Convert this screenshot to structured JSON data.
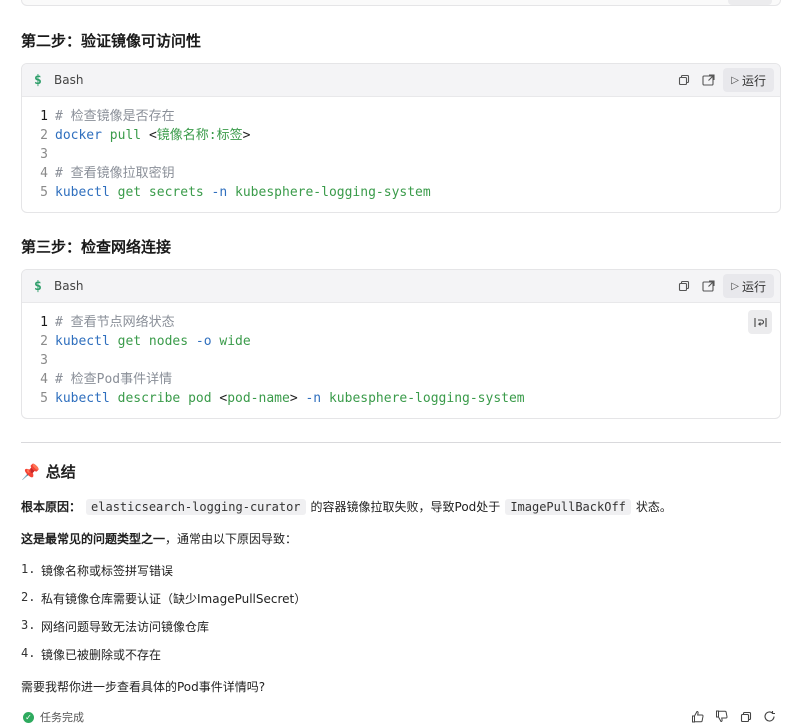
{
  "step2": {
    "title": "第二步：验证镜像可访问性",
    "code": {
      "lang_icon": "$",
      "lang": "Bash",
      "run_label": "运行",
      "lines": [
        {
          "n": "1",
          "comment": "# 检查镜像是否存在"
        },
        {
          "n": "2",
          "cmd": "docker",
          "args": " pull ",
          "plain": "<",
          "kw": "镜像名称:标签",
          "plain2": ">"
        },
        {
          "n": "3"
        },
        {
          "n": "4",
          "comment": "# 查看镜像拉取密钥"
        },
        {
          "n": "5",
          "cmd": "kubectl",
          "args": " get secrets ",
          "flag": "-n",
          "kw": " kubesphere-logging-system"
        }
      ]
    }
  },
  "step3": {
    "title": "第三步：检查网络连接",
    "code": {
      "lang_icon": "$",
      "lang": "Bash",
      "run_label": "运行",
      "lines": [
        {
          "n": "1",
          "comment": "# 查看节点网络状态"
        },
        {
          "n": "2",
          "cmd": "kubectl",
          "args": " get nodes ",
          "flag": "-o",
          "kw": " wide"
        },
        {
          "n": "3"
        },
        {
          "n": "4",
          "comment": "# 检查Pod事件详情"
        },
        {
          "n": "5",
          "cmd": "kubectl",
          "args": " describe pod ",
          "plain": "<",
          "kw": "pod-name",
          "plain2": "> ",
          "flag": "-n",
          "kw2": " kubesphere-logging-system"
        }
      ]
    }
  },
  "summary": {
    "title": "总结",
    "pin_icon": "pushpin-icon",
    "root_cause_label": "根本原因：",
    "root_cause_code1": "elasticsearch-logging-curator",
    "root_cause_text1": "的容器镜像拉取失败，导致Pod处于",
    "root_cause_code2": "ImagePullBackOff",
    "root_cause_text2": "状态。",
    "common_bold": "这是最常见的问题类型之一",
    "common_rest": "，通常由以下原因导致：",
    "reasons": [
      {
        "n": "1.",
        "text": "镜像名称或标签拼写错误"
      },
      {
        "n": "2.",
        "text": "私有镜像仓库需要认证（缺少ImagePullSecret）"
      },
      {
        "n": "3.",
        "text": "网络问题导致无法访问镜像仓库"
      },
      {
        "n": "4.",
        "text": "镜像已被删除或不存在"
      }
    ],
    "question": "需要我帮你进一步查看具体的Pod事件详情吗?"
  },
  "footer": {
    "status": "任务完成",
    "status_color": "#2eaa5e",
    "actions": [
      "thumbs-up-icon",
      "thumbs-down-icon",
      "copy-icon",
      "refresh-icon"
    ]
  }
}
